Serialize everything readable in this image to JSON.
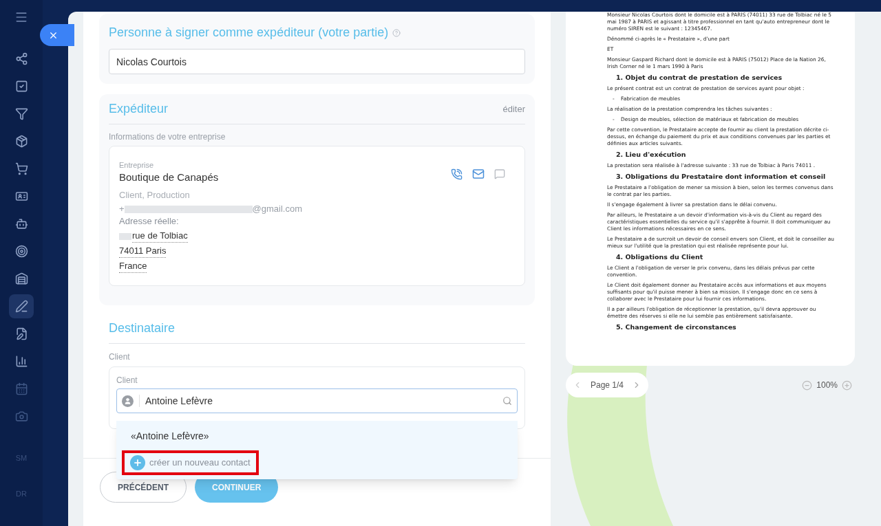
{
  "sidebar": {
    "items": [
      {
        "selected": false
      },
      {
        "selected": false
      },
      {
        "selected": false
      },
      {
        "selected": false
      },
      {
        "selected": false
      },
      {
        "selected": false
      },
      {
        "selected": false
      },
      {
        "selected": false
      },
      {
        "selected": false
      },
      {
        "selected": true
      },
      {
        "selected": false
      },
      {
        "selected": false
      },
      {
        "selected": false
      },
      {
        "selected": false
      }
    ],
    "texts": [
      "SM",
      "DR"
    ]
  },
  "form": {
    "signer": {
      "title": "Personne à signer comme expéditeur (votre partie)",
      "value": "Nicolas Courtois"
    },
    "sender": {
      "title": "Expéditeur",
      "edit": "éditer",
      "subtitle": "Informations de votre entreprise",
      "company_label": "Entreprise",
      "company": "Boutique de Canapés",
      "type": "Client, Production",
      "phone_prefix": "+",
      "email_suffix": "@gmail.com",
      "address_label": "Adresse réelle:",
      "address": [
        "rue de Tolbiac",
        "74011 Paris",
        "France"
      ]
    },
    "recipient": {
      "title": "Destinataire",
      "label": "Client",
      "field_label": "Client",
      "value": "Antoine Lefèvre",
      "suggestions": [
        {
          "kind": "result",
          "text": "«Antoine Lefèvre»",
          "highlighted": false
        },
        {
          "kind": "create",
          "text": "créer un nouveau contact",
          "highlighted": true
        }
      ]
    },
    "buttons": [
      {
        "label": "PRÉCÉDENT",
        "kind": "secondary"
      },
      {
        "label": "CONTINUER",
        "kind": "primary"
      }
    ]
  },
  "document": {
    "blocks": [
      {
        "kind": "p",
        "text": "Monsieur Nicolas Courtois dont le domicile est à PARIS (74011) 33 rue de Tolbiac  né le 5 mai 1987 à PARIS et agissant à titre professionnel en tant qu'auto entrepreneur dont le numéro SIREN est le suivant : 12345467."
      },
      {
        "kind": "p",
        "text": "Dénommé  ci-après  le « Prestataire  », d'une part"
      },
      {
        "kind": "p",
        "text": "ET"
      },
      {
        "kind": "p",
        "text": "Monsieur Gaspard Richard dont le domicile est à PARIS (75012) Place de la Nation 26, Irish Corner  né le 1 mars 1990 à Paris"
      },
      {
        "kind": "h",
        "text": "1. Objet du contrat de prestation de services"
      },
      {
        "kind": "p",
        "text": "Le présent contrat est un contrat de prestation de services ayant pour objet :"
      },
      {
        "kind": "li",
        "text": "-    Fabrication de meubles"
      },
      {
        "kind": "p",
        "text": "La réalisation de la prestation comprendra les tâches suivantes :"
      },
      {
        "kind": "li",
        "text": "-    Design de meubles, sélection de matériaux et fabrication de meubles"
      },
      {
        "kind": "p",
        "text": "Par cette convention, le Prestataire accepte de fournir au client la prestation décrite ci-dessus, en échange du paiement du prix et aux conditions convenues par les parties et définies aux articles suivants."
      },
      {
        "kind": "h",
        "text": "2. Lieu d'exécution"
      },
      {
        "kind": "p",
        "text": "La prestation sera réalisée à l'adresse suivante : 33 rue de Tolbiac à Paris 74011 ."
      },
      {
        "kind": "h",
        "text": "3. Obligations du Prestataire dont information et conseil"
      },
      {
        "kind": "p",
        "text": "Le Prestataire a l'obligation de mener sa mission à bien, selon les termes convenus dans le contrat par les parties."
      },
      {
        "kind": "p",
        "text": "Il s'engage également à livrer sa prestation dans le délai convenu."
      },
      {
        "kind": "p",
        "text": "Par ailleurs, le Prestataire a un devoir d'information vis-à-vis du Client au regard des caractéristiques essentielles du service qu'il s'apprête à fournir. Il doit communiquer au Client les informations nécessaires en ce sens."
      },
      {
        "kind": "p",
        "text": "Le Prestataire a de surcroit un devoir de conseil envers son Client, et doit le conseiller au mieux sur l'utilité que la prestation qui est réalisée représente pour lui."
      },
      {
        "kind": "h",
        "text": "4. Obligations du Client"
      },
      {
        "kind": "p",
        "text": "Le Client a l'obligation de verser le prix convenu, dans les délais prévus par cette convention."
      },
      {
        "kind": "p",
        "text": "Le Client doit également donner au Prestataire accès aux informations et aux moyens suffisants pour qu'il puisse mener à bien sa mission. Il s'engage donc en ce sens à collaborer avec le Prestataire pour lui fournir ces informations."
      },
      {
        "kind": "p",
        "text": "Il a par ailleurs l'obligation de réceptionner la prestation, qu'il devra approuver ou émettre des réserves si elle ne lui semble pas entièrement satisfaisante."
      },
      {
        "kind": "h",
        "text": "5. Changement de circonstances"
      }
    ],
    "page": "Page 1/4",
    "zoom": "100%"
  }
}
